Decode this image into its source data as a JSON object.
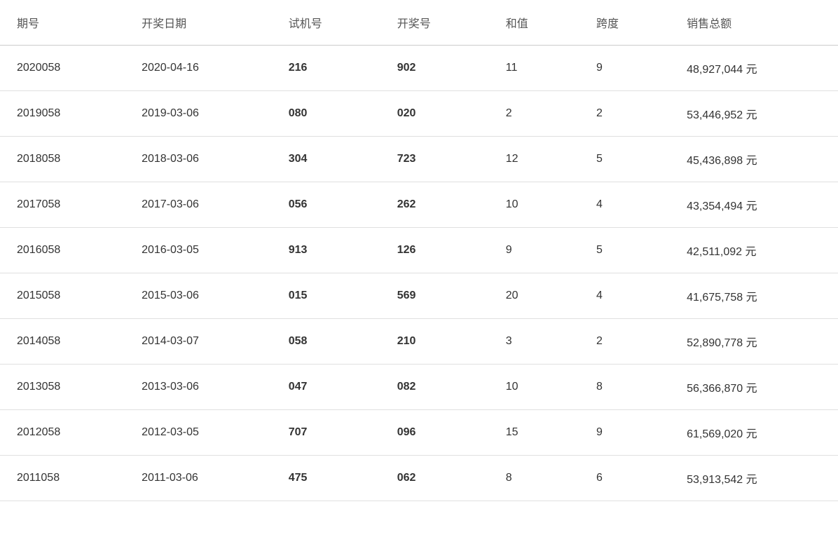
{
  "table": {
    "columns": [
      {
        "key": "period",
        "label": "期号"
      },
      {
        "key": "draw_date",
        "label": "开奖日期"
      },
      {
        "key": "trial_num",
        "label": "试机号"
      },
      {
        "key": "winning_num",
        "label": "开奖号"
      },
      {
        "key": "sum",
        "label": "和值"
      },
      {
        "key": "span",
        "label": "跨度"
      },
      {
        "key": "sales_total",
        "label": "销售总额"
      }
    ],
    "rows": [
      {
        "period": "2020058",
        "draw_date": "2020-04-16",
        "trial_num": "216",
        "winning_num": "902",
        "sum": "11",
        "span": "9",
        "sales_total": "48,927,044 元"
      },
      {
        "period": "2019058",
        "draw_date": "2019-03-06",
        "trial_num": "080",
        "winning_num": "020",
        "sum": "2",
        "span": "2",
        "sales_total": "53,446,952 元"
      },
      {
        "period": "2018058",
        "draw_date": "2018-03-06",
        "trial_num": "304",
        "winning_num": "723",
        "sum": "12",
        "span": "5",
        "sales_total": "45,436,898 元"
      },
      {
        "period": "2017058",
        "draw_date": "2017-03-06",
        "trial_num": "056",
        "winning_num": "262",
        "sum": "10",
        "span": "4",
        "sales_total": "43,354,494 元"
      },
      {
        "period": "2016058",
        "draw_date": "2016-03-05",
        "trial_num": "913",
        "winning_num": "126",
        "sum": "9",
        "span": "5",
        "sales_total": "42,511,092 元"
      },
      {
        "period": "2015058",
        "draw_date": "2015-03-06",
        "trial_num": "015",
        "winning_num": "569",
        "sum": "20",
        "span": "4",
        "sales_total": "41,675,758 元"
      },
      {
        "period": "2014058",
        "draw_date": "2014-03-07",
        "trial_num": "058",
        "winning_num": "210",
        "sum": "3",
        "span": "2",
        "sales_total": "52,890,778 元"
      },
      {
        "period": "2013058",
        "draw_date": "2013-03-06",
        "trial_num": "047",
        "winning_num": "082",
        "sum": "10",
        "span": "8",
        "sales_total": "56,366,870 元"
      },
      {
        "period": "2012058",
        "draw_date": "2012-03-05",
        "trial_num": "707",
        "winning_num": "096",
        "sum": "15",
        "span": "9",
        "sales_total": "61,569,020 元"
      },
      {
        "period": "2011058",
        "draw_date": "2011-03-06",
        "trial_num": "475",
        "winning_num": "062",
        "sum": "8",
        "span": "6",
        "sales_total": "53,913,542 元"
      }
    ]
  }
}
